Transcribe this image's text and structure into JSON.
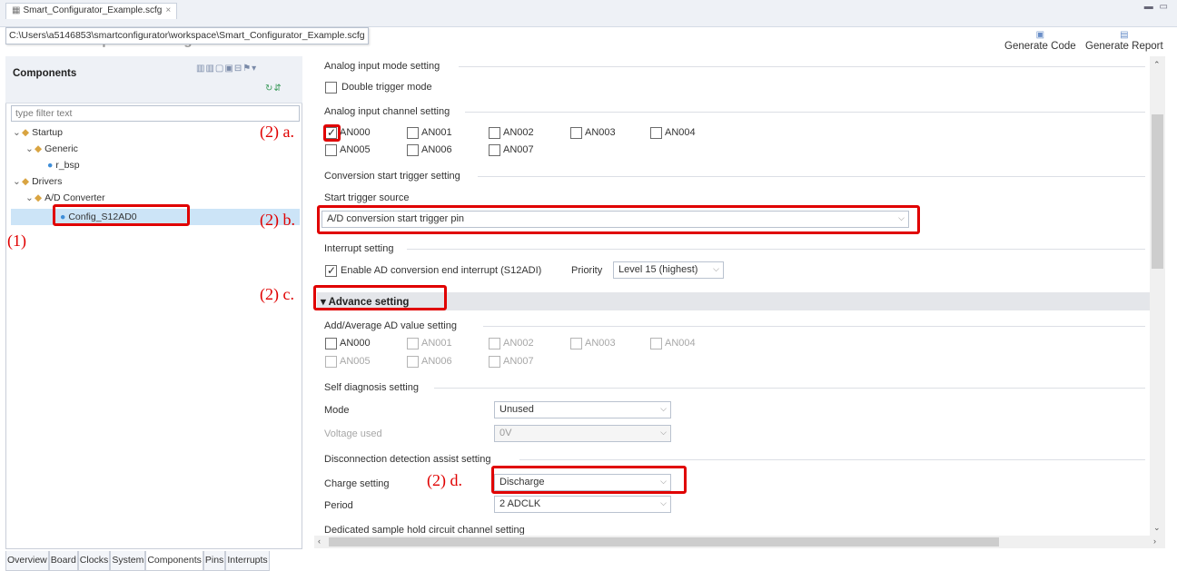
{
  "editor": {
    "tab_title": "Smart_Configurator_Example.scfg",
    "path_tooltip": "C:\\Users\\a5146853\\smartconfigurator\\workspace\\Smart_Configurator_Example.scfg",
    "header_title": "Software component configuration"
  },
  "toolbar": {
    "generate_code": "Generate Code",
    "generate_report": "Generate Report"
  },
  "components": {
    "title": "Components",
    "filter_placeholder": "type filter text",
    "tree": [
      {
        "label": "Startup",
        "level": 0,
        "type": "folder",
        "expanded": true
      },
      {
        "label": "Generic",
        "level": 1,
        "type": "folder",
        "expanded": true
      },
      {
        "label": "r_bsp",
        "level": 2,
        "type": "leaf"
      },
      {
        "label": "Drivers",
        "level": 0,
        "type": "folder",
        "expanded": true
      },
      {
        "label": "A/D Converter",
        "level": 1,
        "type": "folder",
        "expanded": true
      },
      {
        "label": "Config_S12AD0",
        "level": 2,
        "type": "leaf",
        "selected": true
      }
    ]
  },
  "bottom_tabs": [
    "Overview",
    "Board",
    "Clocks",
    "System",
    "Components",
    "Pins",
    "Interrupts"
  ],
  "active_bottom_tab": "Components",
  "settings": {
    "analog_input_mode": {
      "label": "Analog input mode setting",
      "double_trigger": {
        "label": "Double trigger mode",
        "checked": false
      }
    },
    "analog_input_channel": {
      "label": "Analog input channel setting",
      "channels": [
        {
          "name": "AN000",
          "checked": true
        },
        {
          "name": "AN001",
          "checked": false
        },
        {
          "name": "AN002",
          "checked": false
        },
        {
          "name": "AN003",
          "checked": false
        },
        {
          "name": "AN004",
          "checked": false
        },
        {
          "name": "AN005",
          "checked": false
        },
        {
          "name": "AN006",
          "checked": false
        },
        {
          "name": "AN007",
          "checked": false
        }
      ]
    },
    "conversion_start_trigger": {
      "label": "Conversion start trigger setting",
      "source_label": "Start trigger source",
      "source_value": "A/D conversion start trigger pin"
    },
    "interrupt": {
      "label": "Interrupt setting",
      "enable_label": "Enable AD conversion end interrupt (S12ADI)",
      "enable_checked": true,
      "priority_label": "Priority",
      "priority_value": "Level 15 (highest)"
    },
    "advance": {
      "label": "Advance setting",
      "add_average": {
        "label": "Add/Average AD value setting",
        "channels": [
          {
            "name": "AN000",
            "enabled": true
          },
          {
            "name": "AN001",
            "enabled": false
          },
          {
            "name": "AN002",
            "enabled": false
          },
          {
            "name": "AN003",
            "enabled": false
          },
          {
            "name": "AN004",
            "enabled": false
          },
          {
            "name": "AN005",
            "enabled": false
          },
          {
            "name": "AN006",
            "enabled": false
          },
          {
            "name": "AN007",
            "enabled": false
          }
        ]
      },
      "self_diagnosis": {
        "label": "Self diagnosis setting",
        "mode_label": "Mode",
        "mode_value": "Unused",
        "voltage_label": "Voltage used",
        "voltage_value": "0V"
      },
      "disconnection": {
        "label": "Disconnection detection assist setting",
        "charge_label": "Charge setting",
        "charge_value": "Discharge",
        "period_label": "Period",
        "period_value": "2 ADCLK"
      },
      "dedicated_sample_hold": {
        "label": "Dedicated sample hold circuit channel setting"
      }
    }
  },
  "annotations": {
    "step1": "(1)",
    "step2a": "(2) a.",
    "step2b": "(2) b.",
    "step2c": "(2) c.",
    "step2d": "(2) d.",
    "color": "#e00000"
  },
  "icons": {
    "check": "✓",
    "dropdown": "⌵"
  }
}
